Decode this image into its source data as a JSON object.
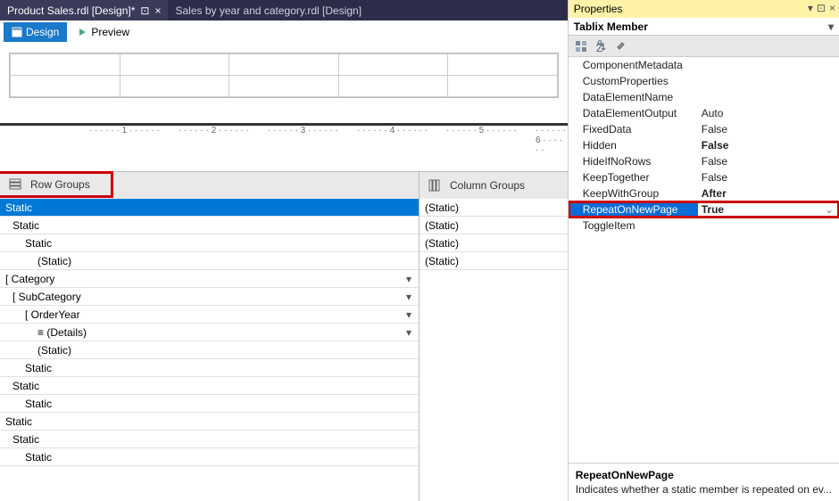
{
  "doc_tabs": [
    {
      "label": "Product Sales.rdl [Design]*",
      "active": true
    },
    {
      "label": "Sales by year and category.rdl [Design]",
      "active": false
    }
  ],
  "design_toolbar": {
    "design": "Design",
    "preview": "Preview"
  },
  "ruler_marks": [
    "1",
    "2",
    "3",
    "4",
    "5",
    "6"
  ],
  "row_groups_title": "Row Groups",
  "column_groups_title": "Column Groups",
  "row_groups": [
    {
      "label": "Static",
      "indent": 0,
      "selected": true,
      "dd": false
    },
    {
      "label": "Static",
      "indent": 1,
      "dd": false
    },
    {
      "label": "Static",
      "indent": 2,
      "dd": false
    },
    {
      "label": "(Static)",
      "indent": 3,
      "dd": false
    },
    {
      "label": "Category",
      "indent": 0,
      "dd": true,
      "bracket": true
    },
    {
      "label": "SubCategory",
      "indent": 1,
      "dd": true,
      "bracket": true
    },
    {
      "label": "OrderYear",
      "indent": 2,
      "dd": true,
      "bracket": true
    },
    {
      "label": "(Details)",
      "indent": 3,
      "dd": true,
      "details": true
    },
    {
      "label": "(Static)",
      "indent": 3,
      "dd": false
    },
    {
      "label": "Static",
      "indent": 2,
      "dd": false
    },
    {
      "label": "Static",
      "indent": 1,
      "dd": false
    },
    {
      "label": "Static",
      "indent": 2,
      "dd": false
    },
    {
      "label": "Static",
      "indent": 0,
      "dd": false
    },
    {
      "label": "Static",
      "indent": 1,
      "dd": false
    },
    {
      "label": "Static",
      "indent": 2,
      "dd": false
    }
  ],
  "column_groups": [
    {
      "label": "(Static)"
    },
    {
      "label": "(Static)"
    },
    {
      "label": "(Static)"
    },
    {
      "label": "(Static)"
    }
  ],
  "properties": {
    "title": "Properties",
    "subject": "Tablix Member",
    "rows": [
      {
        "name": "ComponentMetadata",
        "value": ""
      },
      {
        "name": "CustomProperties",
        "value": ""
      },
      {
        "name": "DataElementName",
        "value": ""
      },
      {
        "name": "DataElementOutput",
        "value": "Auto"
      },
      {
        "name": "FixedData",
        "value": "False"
      },
      {
        "name": "Hidden",
        "value": "False",
        "bold": true
      },
      {
        "name": "HideIfNoRows",
        "value": "False"
      },
      {
        "name": "KeepTogether",
        "value": "False"
      },
      {
        "name": "KeepWithGroup",
        "value": "After",
        "bold": true
      },
      {
        "name": "RepeatOnNewPage",
        "value": "True",
        "bold": true,
        "highlight": true
      },
      {
        "name": "ToggleItem",
        "value": ""
      }
    ],
    "desc_title": "RepeatOnNewPage",
    "desc_text": "Indicates whether a static member is repeated on ev..."
  }
}
